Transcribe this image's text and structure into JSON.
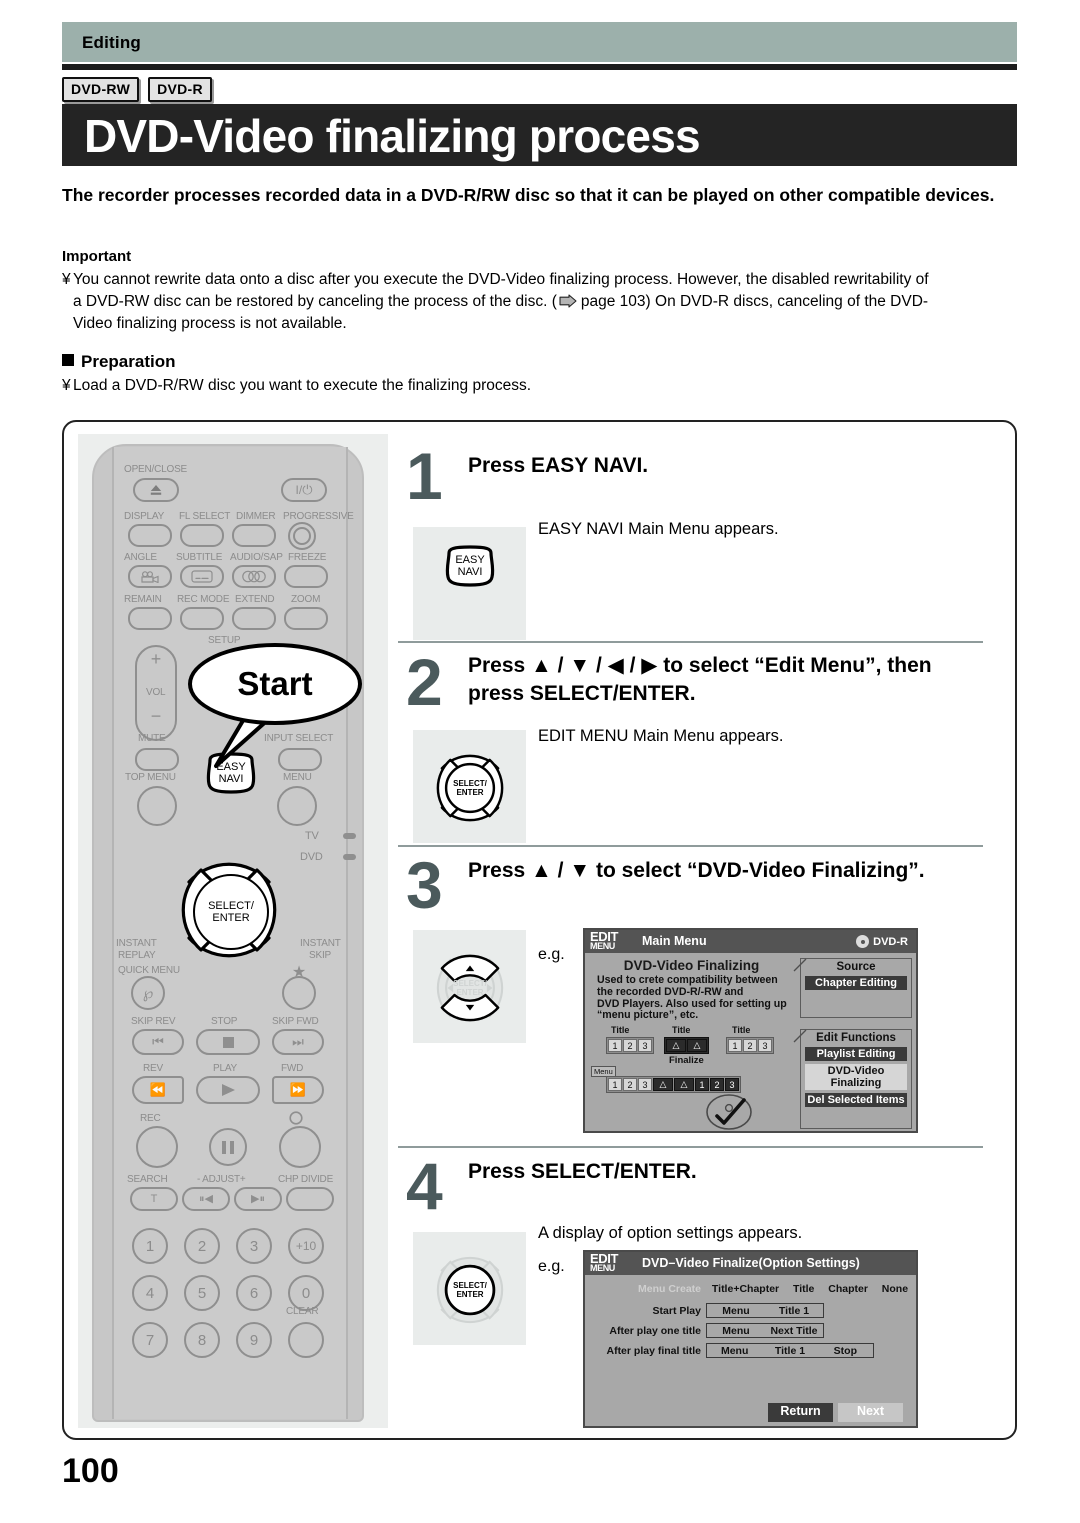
{
  "header": {
    "section_label": "Editing",
    "badges": [
      "DVD-RW",
      "DVD-R"
    ],
    "title": "DVD-Video finalizing process"
  },
  "intro": {
    "text": "The recorder processes recorded data in a DVD-R/RW disc so that it can be played on other compatible devices."
  },
  "important": {
    "heading": "Important",
    "line1": "You cannot rewrite data onto a disc after you execute the DVD-Video finalizing process. However, the disabled rewritability of",
    "line2_a": "a DVD-RW disc can be restored by canceling the process of the disc. (",
    "line2_b": "page 103) On DVD-R discs, canceling of the DVD-",
    "line3": "Video finalizing process is not available."
  },
  "preparation": {
    "heading": "Preparation",
    "text": "Load a DVD-R/RW disc you want to execute the finalizing process."
  },
  "remote": {
    "callout": "Start",
    "labels": {
      "open_close": "OPEN/CLOSE",
      "display": "DISPLAY",
      "fl_select": "FL SELECT",
      "dimmer": "DIMMER",
      "progressive": "PROGRESSIVE",
      "angle": "ANGLE",
      "subtitle": "SUBTITLE",
      "audio_sap": "AUDIO/SAP",
      "freeze": "FREEZE",
      "remain": "REMAIN",
      "rec_mode": "REC MODE",
      "extend": "EXTEND",
      "zoom": "ZOOM",
      "setup": "SETUP",
      "vol": "VOL",
      "mute": "MUTE",
      "input_select": "INPUT SELECT",
      "top_menu": "TOP MENU",
      "easy_navi_1": "EASY",
      "easy_navi_2": "NAVI",
      "menu": "MENU",
      "tv": "TV",
      "dvd": "DVD",
      "select_enter_1": "SELECT/",
      "select_enter_2": "ENTER",
      "instant_replay_1": "INSTANT",
      "instant_replay_2": "REPLAY",
      "instant_skip_1": "INSTANT",
      "instant_skip_2": "SKIP",
      "quick_menu": "QUICK MENU",
      "skip_rev": "SKIP REV",
      "stop": "STOP",
      "skip_fwd": "SKIP FWD",
      "rev": "REV",
      "play": "PLAY",
      "fwd": "FWD",
      "rec": "REC",
      "search": "SEARCH",
      "adjust": "- ADJUST+",
      "chp_divide": "CHP DIVIDE",
      "clear": "CLEAR"
    },
    "numpad": [
      "1",
      "2",
      "3",
      "+10",
      "4",
      "5",
      "6",
      "0",
      "7",
      "8",
      "9"
    ],
    "search_glyph": "T"
  },
  "steps": [
    {
      "number": "1",
      "title": "Press EASY NAVI.",
      "sub": "EASY NAVI Main Menu appears.",
      "icon": "easy-navi-button"
    },
    {
      "number": "2",
      "title_line1": "Press ▲ / ▼ / ◀ / ▶ to select “Edit Menu”, then",
      "title_line2": "press SELECT/ENTER.",
      "sub": "EDIT MENU Main Menu appears.",
      "icon": "dpad-all-highlighted"
    },
    {
      "number": "3",
      "title": "Press ▲ / ▼ to select “DVD-Video Finalizing”.",
      "eg": "e.g.",
      "icon": "dpad-updown-highlighted"
    },
    {
      "number": "4",
      "title": "Press SELECT/ENTER.",
      "sub": "A display of option settings appears.",
      "eg": "e.g.",
      "icon": "dpad-center-highlighted"
    }
  ],
  "screen_main_menu": {
    "logo_line1": "EDIT",
    "logo_line2": "MENU",
    "title": "Main Menu",
    "disc": "DVD-R",
    "heading": "DVD-Video Finalizing",
    "desc_line1": "Used to crete compatibility between",
    "desc_line2": "the recorded DVD-R/-RW and",
    "desc_line3": "DVD Players. Also used for setting up",
    "desc_line4": "“menu picture”, etc.",
    "title_caption": "Title",
    "finalize_caption": "Finalize",
    "menu_tag": "Menu",
    "chips_group1": [
      "1",
      "2",
      "3"
    ],
    "chips_group2": [
      "△",
      "△"
    ],
    "chips_group3": [
      "1",
      "2",
      "3"
    ],
    "source_box": {
      "caption": "Source",
      "items": [
        {
          "label": "Chapter Editing",
          "style": "dark"
        }
      ]
    },
    "edit_functions_box": {
      "caption": "Edit Functions",
      "items": [
        {
          "label": "Playlist Editing",
          "style": "dark"
        },
        {
          "label": "DVD-Video Finalizing",
          "style": "light"
        },
        {
          "label": "Del Selected Items",
          "style": "dark"
        }
      ]
    }
  },
  "screen_option_settings": {
    "logo_line1": "EDIT",
    "logo_line2": "MENU",
    "title": "DVD–Video Finalize(Option Settings)",
    "rows": [
      {
        "label": "Menu Create",
        "label_style": "ghost",
        "boxed": false,
        "cells": [
          "Title+Chapter",
          "Title",
          "Chapter",
          "None"
        ]
      },
      {
        "label": "Start Play",
        "label_style": "normal",
        "boxed": true,
        "cells": [
          "Menu",
          "Title 1"
        ]
      },
      {
        "label": "After play one title",
        "label_style": "normal",
        "boxed": true,
        "cells": [
          "Menu",
          "Next Title"
        ]
      },
      {
        "label": "After play final title",
        "label_style": "normal",
        "boxed": true,
        "cells": [
          "Menu",
          "Title 1",
          "Stop"
        ]
      }
    ],
    "buttons": [
      {
        "label": "Return",
        "style": "dark"
      },
      {
        "label": "Next",
        "style": "light"
      }
    ]
  },
  "footer": {
    "page_number": "100"
  },
  "colors": {
    "header_band": "#9cb0ab",
    "title_band": "#242424",
    "step_number": "#4b5a5c",
    "panel_bg": "#e9eceb",
    "screen_bg": "#a8a8a8",
    "screen_bar": "#545454"
  }
}
